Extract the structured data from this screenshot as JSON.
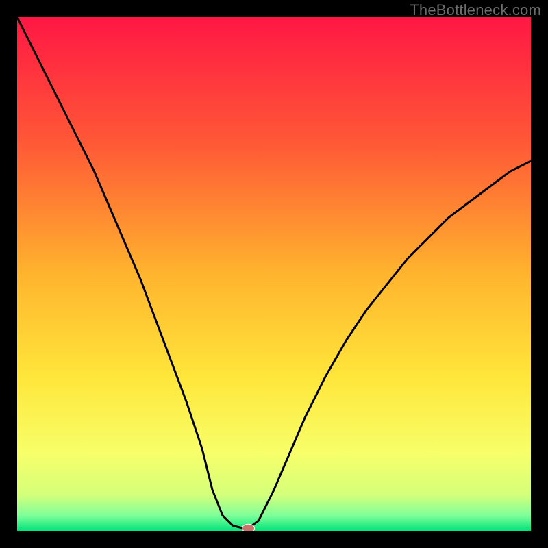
{
  "watermark": "TheBottleneck.com",
  "chart_data": {
    "type": "line",
    "title": "",
    "xlabel": "",
    "ylabel": "",
    "xlim": [
      0,
      100
    ],
    "ylim": [
      0,
      100
    ],
    "x": [
      0,
      3,
      6,
      9,
      12,
      15,
      18,
      21,
      24,
      27,
      30,
      33,
      36,
      38,
      40,
      42,
      44,
      45,
      47,
      50,
      53,
      56,
      60,
      64,
      68,
      72,
      76,
      80,
      84,
      88,
      92,
      96,
      100
    ],
    "y": [
      100,
      94,
      88,
      82,
      76,
      70,
      63,
      56,
      49,
      41,
      33,
      25,
      16,
      8,
      3,
      1,
      0.5,
      0.5,
      2,
      8,
      15,
      22,
      30,
      37,
      43,
      48,
      53,
      57,
      61,
      64,
      67,
      70,
      72
    ],
    "marker": {
      "x": 45,
      "y": 0.5
    },
    "gradient_stops": [
      {
        "offset": 0.0,
        "color": "#ff1744"
      },
      {
        "offset": 0.25,
        "color": "#ff5a36"
      },
      {
        "offset": 0.5,
        "color": "#ffb42e"
      },
      {
        "offset": 0.7,
        "color": "#ffe63a"
      },
      {
        "offset": 0.85,
        "color": "#f7ff6a"
      },
      {
        "offset": 0.93,
        "color": "#d4ff7a"
      },
      {
        "offset": 0.97,
        "color": "#7fff9a"
      },
      {
        "offset": 1.0,
        "color": "#00e37a"
      }
    ],
    "colors": {
      "curve": "#000000",
      "marker_fill": "#c9736b",
      "marker_stroke": "#ffffff",
      "frame": "#000000"
    }
  }
}
